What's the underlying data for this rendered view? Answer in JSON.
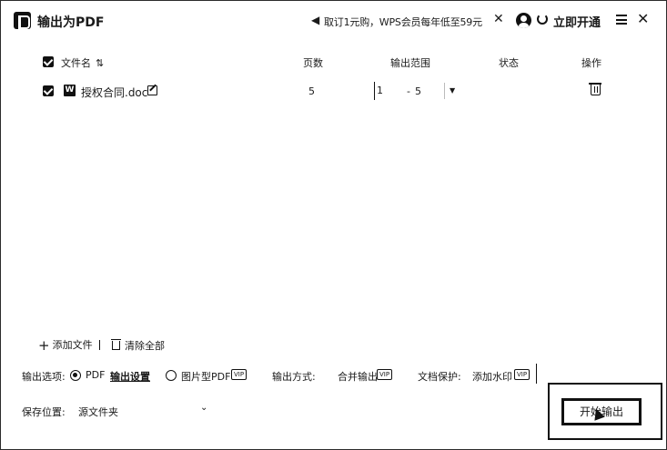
{
  "window": {
    "title": "输出为PDF",
    "promo_text": "取订1元购，WPS会员每年低至59元",
    "open_vip_label": "立即开通"
  },
  "table": {
    "headers": {
      "filename": "文件名",
      "pages": "页数",
      "range": "输出范围",
      "status": "状态",
      "actions": "操作"
    },
    "rows": [
      {
        "filename": "授权合同.doc",
        "pages": "5",
        "range_from": "1",
        "range_to": "5",
        "status": ""
      }
    ]
  },
  "actions": {
    "add_file": "添加文件",
    "clear_all": "清除全部"
  },
  "options": {
    "output_options_label": "输出选项:",
    "pdf_label": "PDF",
    "output_settings": "输出设置",
    "image_pdf_label": "图片型PDF",
    "output_mode_label": "输出方式:",
    "merge_output": "合并输出",
    "doc_protect_label": "文档保护:",
    "add_watermark": "添加水印",
    "vip_badge": "VIP"
  },
  "save": {
    "label": "保存位置:",
    "value": "源文件夹"
  },
  "export_button": "开始输出"
}
